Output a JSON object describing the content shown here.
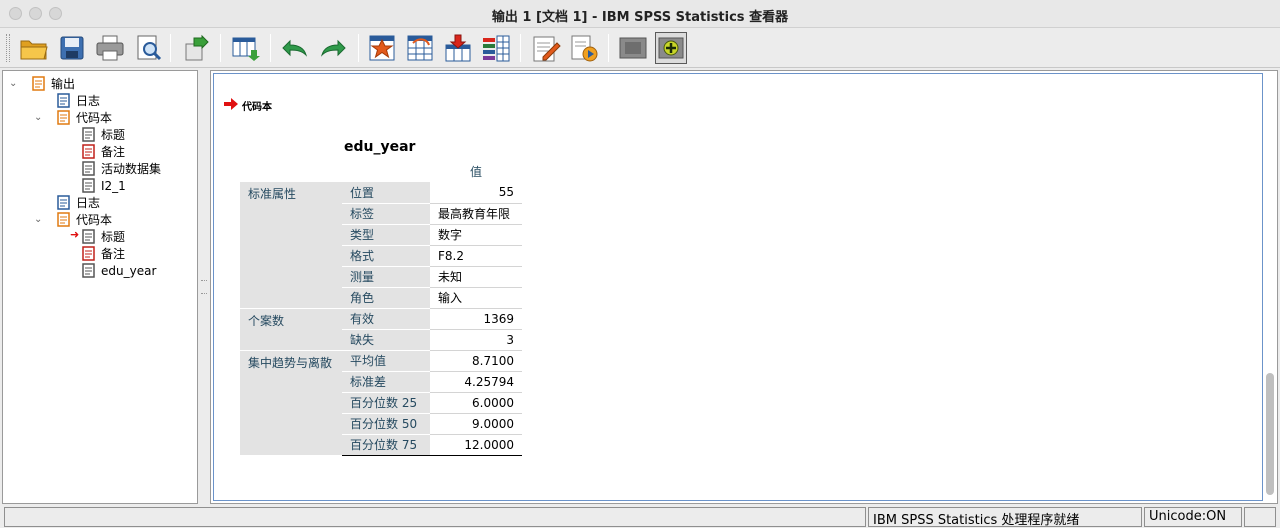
{
  "window": {
    "title": "输出 1 [文档 1] - IBM SPSS Statistics 查看器"
  },
  "toolbar": {
    "buttons": [
      {
        "name": "open-icon"
      },
      {
        "name": "save-icon"
      },
      {
        "name": "print-icon"
      },
      {
        "name": "print-preview-icon"
      },
      {
        "name": "export-icon"
      },
      {
        "name": "goto-data-icon"
      },
      {
        "name": "undo-icon"
      },
      {
        "name": "redo-icon"
      },
      {
        "name": "goto-case-icon"
      },
      {
        "name": "goto-variable-icon"
      },
      {
        "name": "insert-cases-icon"
      },
      {
        "name": "variables-icon"
      },
      {
        "name": "syntax-icon"
      },
      {
        "name": "run-script-icon"
      },
      {
        "name": "hide-icon"
      },
      {
        "name": "show-icon"
      }
    ]
  },
  "nav": {
    "items": [
      {
        "label": "输出",
        "level": 0,
        "icon": "output-book-icon",
        "expanded": true
      },
      {
        "label": "日志",
        "level": 1,
        "icon": "log-icon"
      },
      {
        "label": "代码本",
        "level": 1,
        "icon": "codebook-icon",
        "expanded": true
      },
      {
        "label": "标题",
        "level": 2,
        "icon": "title-icon"
      },
      {
        "label": "备注",
        "level": 2,
        "icon": "notes-icon"
      },
      {
        "label": "活动数据集",
        "level": 2,
        "icon": "dataset-icon"
      },
      {
        "label": "I2_1",
        "level": 2,
        "icon": "table-icon"
      },
      {
        "label": "日志",
        "level": 1,
        "icon": "log-icon"
      },
      {
        "label": "代码本",
        "level": 1,
        "icon": "codebook-icon",
        "expanded": true
      },
      {
        "label": "标题",
        "level": 2,
        "icon": "title-icon",
        "current": true
      },
      {
        "label": "备注",
        "level": 2,
        "icon": "notes-icon"
      },
      {
        "label": "edu_year",
        "level": 2,
        "icon": "table-icon"
      }
    ]
  },
  "content": {
    "section_label": "代码本",
    "table": {
      "title": "edu_year",
      "value_header": "值",
      "groups": [
        {
          "name": "标准属性",
          "rows": [
            {
              "label": "位置",
              "value": "55",
              "align": "right"
            },
            {
              "label": "标签",
              "value": "最高教育年限",
              "align": "left"
            },
            {
              "label": "类型",
              "value": "数字",
              "align": "left"
            },
            {
              "label": "格式",
              "value": "F8.2",
              "align": "left"
            },
            {
              "label": "测量",
              "value": "未知",
              "align": "left"
            },
            {
              "label": "角色",
              "value": "输入",
              "align": "left"
            }
          ]
        },
        {
          "name": "个案数",
          "rows": [
            {
              "label": "有效",
              "value": "1369",
              "align": "right"
            },
            {
              "label": "缺失",
              "value": "3",
              "align": "right"
            }
          ]
        },
        {
          "name": "集中趋势与离散",
          "rows": [
            {
              "label": "平均值",
              "value": "8.7100",
              "align": "right"
            },
            {
              "label": "标准差",
              "value": "4.25794",
              "align": "right"
            },
            {
              "label": "百分位数 25",
              "value": "6.0000",
              "align": "right"
            },
            {
              "label": "百分位数 50",
              "value": "9.0000",
              "align": "right"
            },
            {
              "label": "百分位数 75",
              "value": "12.0000",
              "align": "right"
            }
          ]
        }
      ]
    }
  },
  "status": {
    "processor": "IBM SPSS Statistics 处理程序就绪",
    "unicode": "Unicode:ON"
  }
}
